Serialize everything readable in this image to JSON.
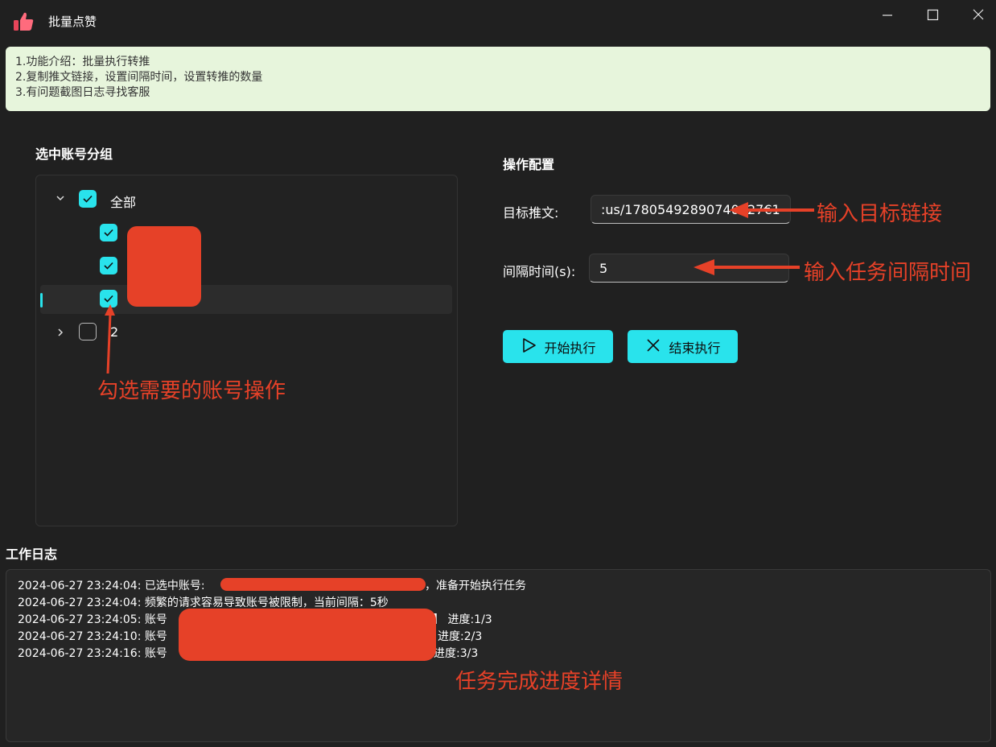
{
  "window": {
    "title": "批量点赞",
    "icon": "thumbs-up-icon",
    "controls": [
      "minimize-icon",
      "maximize-icon",
      "close-icon"
    ]
  },
  "info": {
    "lines": [
      "1.功能介绍：批量执行转推",
      "2.复制推文链接，设置间隔时间，设置转推的数量",
      "3.有问题截图日志寻找客服"
    ]
  },
  "groups": {
    "title": "选中账号分组",
    "all_label": "全部",
    "group2_label": "2"
  },
  "config": {
    "title": "操作配置",
    "target_label": "目标推文:",
    "target_value": ":us/17805492890740027€1",
    "interval_label": "间隔时间(s):",
    "interval_value": "5",
    "start_label": "开始执行",
    "stop_label": "结束执行"
  },
  "log": {
    "title": "工作日志",
    "lines": [
      {
        "prefix": "2024-06-27 23:24:04: 已选中账号:",
        "suffix": "，准备开始执行任务"
      },
      {
        "prefix": "2024-06-27 23:24:04: 频繁的请求容易导致账号被限制，当前间隔：5秒",
        "suffix": ""
      },
      {
        "prefix": "2024-06-27 23:24:05: 账号",
        "suffix": "】 进度:1/3"
      },
      {
        "prefix": "2024-06-27 23:24:10: 账号",
        "suffix": "进度:2/3"
      },
      {
        "prefix": "2024-06-27 23:24:16: 账号",
        "suffix": "进度:3/3"
      }
    ]
  },
  "annotations": {
    "target": "输入目标链接",
    "interval": "输入任务间隔时间",
    "accounts": "勾选需要的账号操作",
    "progress": "任务完成进度详情"
  },
  "colors": {
    "accent": "#29e3ec",
    "annotation": "#e64128",
    "info_bg": "#e7f5dc",
    "background": "#202020"
  }
}
